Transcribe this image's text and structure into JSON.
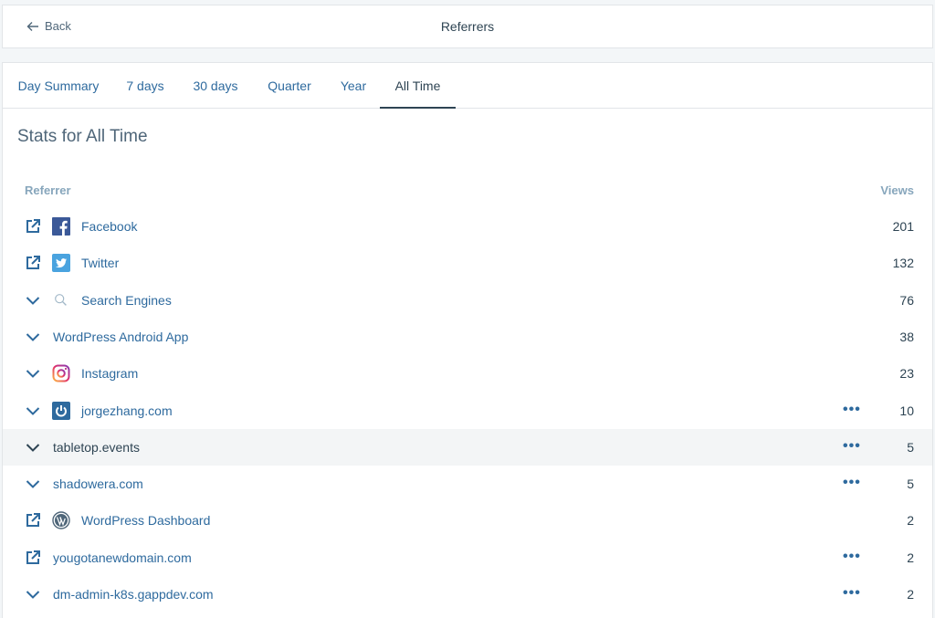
{
  "header": {
    "back_label": "Back",
    "title": "Referrers"
  },
  "tabs": [
    {
      "label": "Day Summary",
      "active": false
    },
    {
      "label": "7 days",
      "active": false
    },
    {
      "label": "30 days",
      "active": false
    },
    {
      "label": "Quarter",
      "active": false
    },
    {
      "label": "Year",
      "active": false
    },
    {
      "label": "All Time",
      "active": true
    }
  ],
  "stats_title": "Stats for All Time",
  "columns": {
    "referrer": "Referrer",
    "views": "Views"
  },
  "rows": [
    {
      "label": "Facebook",
      "views": "201",
      "action": "external-link-icon",
      "brand": "facebook-icon",
      "more": false
    },
    {
      "label": "Twitter",
      "views": "132",
      "action": "external-link-icon",
      "brand": "twitter-icon",
      "more": false
    },
    {
      "label": "Search Engines",
      "views": "76",
      "action": "chevron-down-icon",
      "brand": "search-icon",
      "more": false
    },
    {
      "label": "WordPress Android App",
      "views": "38",
      "action": "chevron-down-icon",
      "brand": "",
      "more": false
    },
    {
      "label": "Instagram",
      "views": "23",
      "action": "chevron-down-icon",
      "brand": "instagram-icon",
      "more": false
    },
    {
      "label": "jorgezhang.com",
      "views": "10",
      "action": "chevron-down-icon",
      "brand": "power-icon",
      "more": true
    },
    {
      "label": "tabletop.events",
      "views": "5",
      "action": "chevron-down-icon",
      "brand": "",
      "more": true,
      "highlight": true
    },
    {
      "label": "shadowera.com",
      "views": "5",
      "action": "chevron-down-icon",
      "brand": "",
      "more": true
    },
    {
      "label": "WordPress Dashboard",
      "views": "2",
      "action": "external-link-icon",
      "brand": "wordpress-icon",
      "more": false
    },
    {
      "label": "yougotanewdomain.com",
      "views": "2",
      "action": "external-link-icon",
      "brand": "",
      "more": true
    },
    {
      "label": "dm-admin-k8s.gappdev.com",
      "views": "2",
      "action": "chevron-down-icon",
      "brand": "",
      "more": true
    }
  ],
  "more_glyph": "•••",
  "colors": {
    "link": "#2e6a9e",
    "text": "#2e4453",
    "muted": "#87a6bc",
    "facebook": "#3b5998",
    "twitter": "#4aa3df",
    "highlight_row": "#f3f5f6"
  }
}
